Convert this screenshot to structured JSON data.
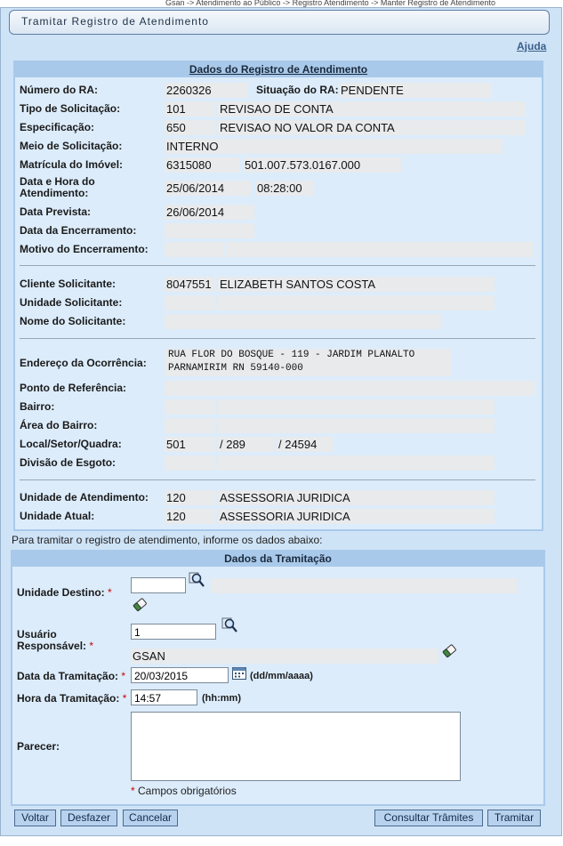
{
  "breadcrumb": "Gsan -> Atendimento ao Público -> Registro Atendimento -> Manter Registro de Atendimento",
  "title": "Tramitar Registro de Atendimento",
  "help": "Ajuda",
  "ra": {
    "header": "Dados do Registro de Atendimento",
    "labels": {
      "numero": "Número do RA:",
      "situacao": "Situação do RA:",
      "tipo": "Tipo de Solicitação:",
      "especificacao": "Especificação:",
      "meio": "Meio de Solicitação:",
      "matricula": "Matrícula do Imóvel:",
      "data_hora": "Data e Hora do Atendimento:",
      "data_prevista": "Data Prevista:",
      "data_encerramento": "Data da Encerramento:",
      "motivo": "Motivo do Encerramento:",
      "cliente": "Cliente Solicitante:",
      "unidade_solicitante": "Unidade Solicitante:",
      "nome_solicitante": "Nome do Solicitante:",
      "endereco": "Endereço da Ocorrência:",
      "ponto": "Ponto de Referência:",
      "bairro": "Bairro:",
      "area_bairro": "Área do Bairro:",
      "local": "Local/Setor/Quadra:",
      "divisao": "Divisão de Esgoto:",
      "unidade_atendimento": "Unidade de Atendimento:",
      "unidade_atual": "Unidade Atual:"
    },
    "values": {
      "numero": "2260326",
      "situacao": "PENDENTE",
      "tipo_codigo": "101",
      "tipo_desc": "REVISAO DE CONTA",
      "espec_codigo": "650",
      "espec_desc": "REVISAO NO VALOR DA CONTA",
      "meio": "INTERNO",
      "matricula": "6315080",
      "inscricao": "501.007.573.0167.000",
      "data_atendimento": "25/06/2014",
      "hora_atendimento": "08:28:00",
      "data_prevista": "26/06/2014",
      "data_encerramento": "",
      "motivo_codigo": "",
      "motivo_desc": "",
      "cliente_codigo": "8047551",
      "cliente_nome": "ELIZABETH SANTOS COSTA",
      "unidade_sol_codigo": "",
      "unidade_sol_desc": "",
      "nome_solicitante": "",
      "endereco_l1": "RUA FLOR DO BOSQUE - 119 - JARDIM PLANALTO",
      "endereco_l2": "PARNAMIRIM RN 59140-000",
      "ponto": "",
      "bairro_codigo": "",
      "bairro_desc": "",
      "area_codigo": "",
      "area_desc": "",
      "local": "501",
      "setor": "/ 289",
      "quadra": "/ 24594",
      "divisao_codigo": "",
      "divisao_desc": "",
      "unidade_atend_codigo": "120",
      "unidade_atend_desc": "ASSESSORIA  JURIDICA",
      "unidade_atual_codigo": "120",
      "unidade_atual_desc": "ASSESSORIA  JURIDICA"
    }
  },
  "instructions": "Para tramitar o registro de atendimento, informe os dados abaixo:",
  "tramitacao": {
    "header": "Dados da Tramitação",
    "labels": {
      "unidade_destino": "Unidade Destino:",
      "usuario": "Usuário Responsável:",
      "data": "Data da Tramitação:",
      "hora": "Hora da Tramitação:",
      "parecer": "Parecer:"
    },
    "required_mark": "*",
    "unidade_destino_value": "",
    "unidade_destino_desc": "",
    "usuario_value": "1",
    "usuario_nome": "GSAN",
    "data_value": "20/03/2015",
    "data_format": "(dd/mm/aaaa)",
    "hora_value": "14:57",
    "hora_format": "(hh:mm)",
    "parecer_value": "",
    "required_note": "Campos obrigatórios"
  },
  "buttons": {
    "voltar": "Voltar",
    "desfazer": "Desfazer",
    "cancelar": "Cancelar",
    "consultar": "Consultar Trâmites",
    "tramitar": "Tramitar"
  },
  "icons": {
    "search": "magnifier-icon",
    "clear": "eraser-icon",
    "calendar": "calendar-icon"
  }
}
